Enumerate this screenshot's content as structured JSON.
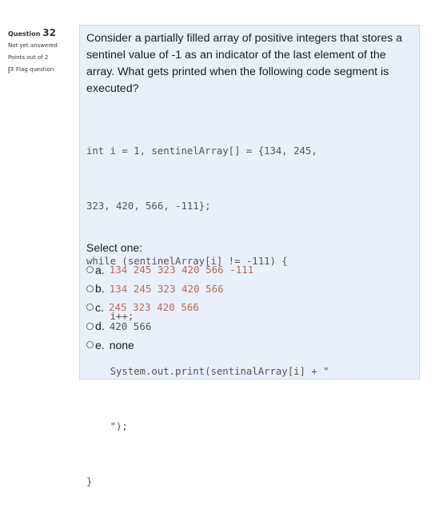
{
  "info": {
    "question_label": "Question",
    "question_number": "32",
    "status": "Not yet answered",
    "points": "Points out of 2",
    "flag_label": "Flag question"
  },
  "question": {
    "text": "Consider a partially filled array of positive integers that stores a sentinel value of -1 as an indicator of the last element of the array. What gets printed when the following code segment is executed?",
    "code": [
      "int i = 1, sentinelArray[] = {134, 245,",
      "323, 420, 566, -111};",
      "while (sentinelArray[i] != -111) {",
      "    i++;",
      "    System.out.print(sentinalArray[i] + \"",
      "    \");",
      "}"
    ]
  },
  "answer": {
    "select_label": "Select one:",
    "options": [
      {
        "letter": "a.",
        "value": "134 245 323 420 566 -111"
      },
      {
        "letter": "b.",
        "value": "134 245 323 420 566"
      },
      {
        "letter": "c.",
        "value": "245 323 420 566"
      },
      {
        "letter": "d.",
        "value": "420 566"
      },
      {
        "letter": "e.",
        "value": "none"
      }
    ]
  },
  "colors": {
    "card_bg": "#e9f0fa",
    "code_value": "#b86a5a"
  }
}
